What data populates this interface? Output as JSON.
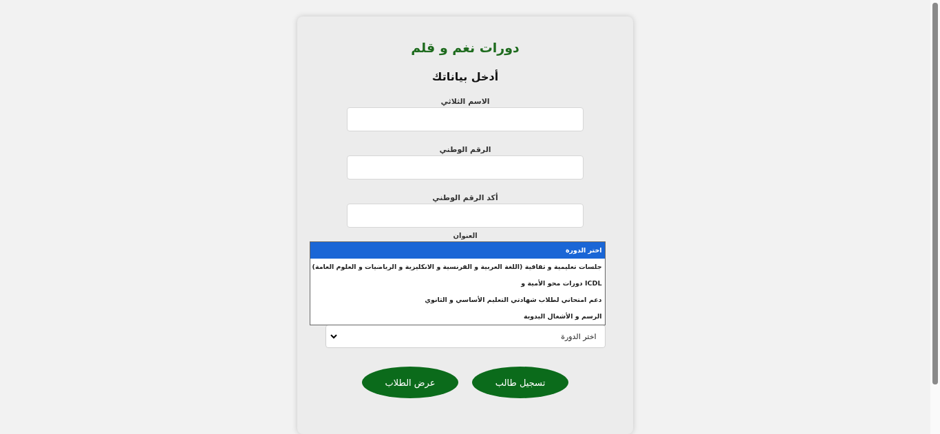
{
  "title": "دورات نغم و قلم",
  "subtitle": "أدخل بياناتك",
  "fields": [
    {
      "label": "الاسم الثلاثي"
    },
    {
      "label": "الرقم الوطني"
    },
    {
      "label": "أكد الرقم الوطني"
    }
  ],
  "address_label": "العنوان",
  "course": {
    "value": "اختر الدورة",
    "expanded": true,
    "options": [
      {
        "label": "اختر الدورة",
        "selected": true
      },
      {
        "label": "جلسات تعليمية و ثقافية (اللغة العربية و الفرنسية و الانكليزية و الرياضيات و العلوم العامة)",
        "selected": false
      },
      {
        "label": "ICDL دورات محو الأمية و",
        "selected": false
      },
      {
        "label": "دعم امتحاني لطلاب شهادتي التعليم الأساسي و الثانوي",
        "selected": false
      },
      {
        "label": "الرسم و الأشغال اليدوية",
        "selected": false
      }
    ]
  },
  "buttons": [
    {
      "label": "تسجيل طالب"
    },
    {
      "label": "عرض الطلاب"
    }
  ]
}
